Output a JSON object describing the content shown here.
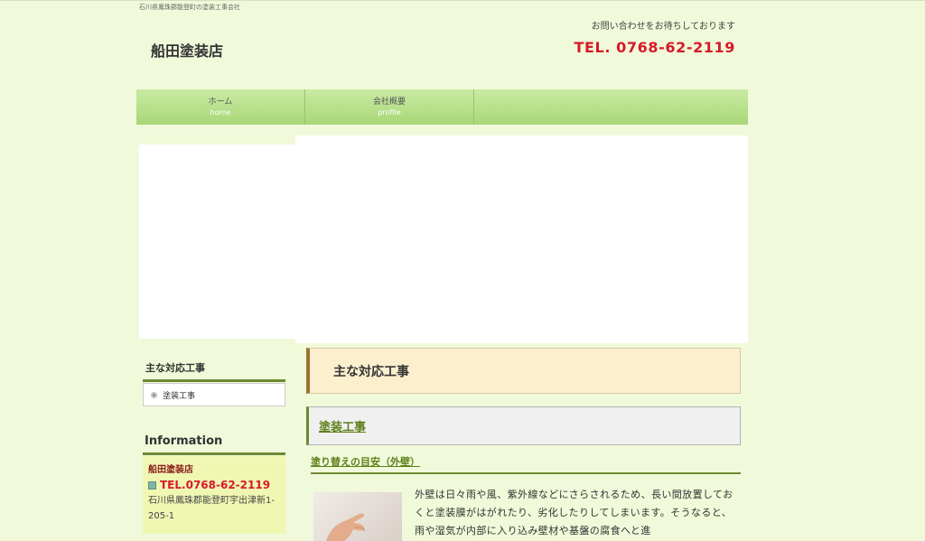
{
  "header": {
    "tagline": "石川県鳳珠郡能登町の塗装工事会社",
    "site_title": "船田塗装店",
    "contact_note": "お問い合わせをお待ちしております",
    "tel": "TEL. 0768-62-2119"
  },
  "nav": [
    {
      "label": "ホーム",
      "sub": "home"
    },
    {
      "label": "会社概要",
      "sub": "profile"
    }
  ],
  "sidebar": {
    "works_title": "主な対応工事",
    "works_items": [
      "塗装工事"
    ],
    "info_title": "Information",
    "info_name": "船田塗装店",
    "info_tel": "TEL.0768-62-2119",
    "info_address": "石川県鳳珠郡能登町宇出津新1-205-1"
  },
  "main": {
    "title": "主な対応工事",
    "subtitle": "塗装工事",
    "section_title": "塗り替えの目安（外壁）",
    "body": "外壁は日々雨や風、紫外線などにさらされるため、長い間放置しておくと塗装膜がはがれたり、劣化したりしてしまいます。そうなると、雨や湿気が内部に入り込み壁材や基盤の腐食へと進"
  },
  "colors": {
    "background": "#f0f9d9",
    "nav": "#b8e08c",
    "tel": "#d7192a",
    "accent": "#6e8a32"
  }
}
